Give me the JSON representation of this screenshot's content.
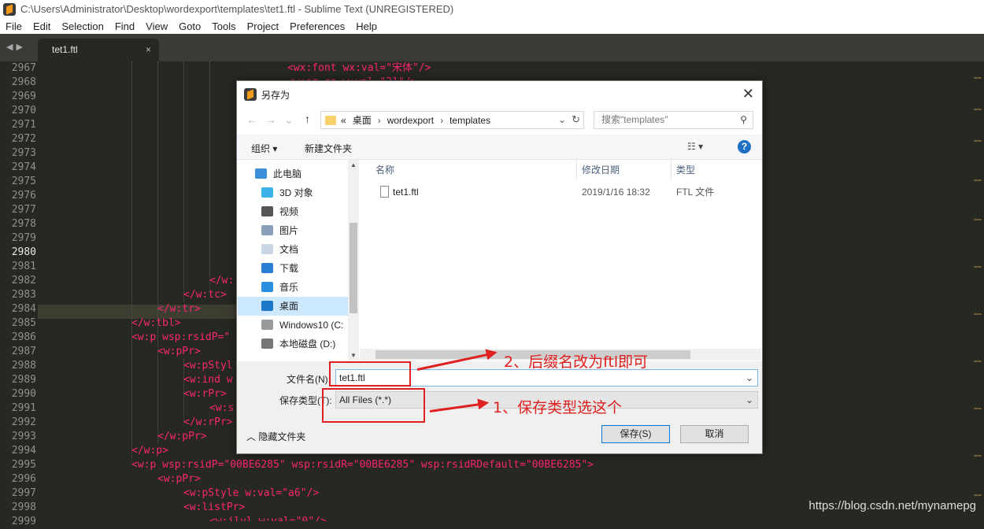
{
  "window": {
    "title": "C:\\Users\\Administrator\\Desktop\\wordexport\\templates\\tet1.ftl - Sublime Text (UNREGISTERED)"
  },
  "menu": [
    "File",
    "Edit",
    "Selection",
    "Find",
    "View",
    "Goto",
    "Tools",
    "Project",
    "Preferences",
    "Help"
  ],
  "tab": {
    "label": "tet1.ftl",
    "close": "×"
  },
  "editor": {
    "line_numbers": [
      "2967",
      "2968",
      "2969",
      "2970",
      "2971",
      "2972",
      "2973",
      "2974",
      "2975",
      "2976",
      "2977",
      "2978",
      "2979",
      "2980",
      "2981",
      "2982",
      "2983",
      "2984",
      "2985",
      "2986",
      "2987",
      "2988",
      "2989",
      "2990",
      "2991",
      "2992",
      "2993",
      "2994",
      "2995",
      "2996",
      "2997",
      "2998",
      "2999"
    ],
    "current_line": "2980",
    "lines": [
      {
        "text": "<wx:font wx:val=\"宋体\"/>"
      },
      {
        "text": "<w:sz-cs w:val=\"21\"/>"
      },
      {
        "text": "</w:"
      },
      {
        "text": "</w:tc>"
      },
      {
        "text": "</w:tr>"
      },
      {
        "text": "</w:tbl>"
      },
      {
        "text": "<w:p wsp:rsidP=\""
      },
      {
        "text": "<w:pPr>"
      },
      {
        "text": "<w:pStyl"
      },
      {
        "text": "<w:ind w"
      },
      {
        "text": "<w:rPr>"
      },
      {
        "text": "<w:s"
      },
      {
        "text": "</w:rPr>"
      },
      {
        "text": "</w:pPr>"
      },
      {
        "text": "</w:p>"
      },
      {
        "text": "<w:p wsp:rsidP=\"00BE6285\" wsp:rsidR=\"00BE6285\" wsp:rsidRDefault=\"00BE6285\">"
      },
      {
        "text": "<w:pPr>"
      },
      {
        "text": "<w:pStyle w:val=\"a6\"/>"
      },
      {
        "text": "<w:listPr>"
      },
      {
        "text": "<w:ilvl w:val=\"0\"/>"
      }
    ]
  },
  "dialog": {
    "title": "另存为",
    "close": "✕",
    "breadcrumbs": [
      "«",
      "桌面",
      "›",
      "wordexport",
      "›",
      "templates"
    ],
    "search_placeholder": "搜索\"templates\"",
    "organize": "组织 ▾",
    "new_folder": "新建文件夹",
    "nav_items": [
      "此电脑",
      "3D 对象",
      "视频",
      "图片",
      "文档",
      "下载",
      "音乐",
      "桌面",
      "Windows10 (C:",
      "本地磁盘 (D:)"
    ],
    "selected_nav": "桌面",
    "columns": {
      "name": "名称",
      "date": "修改日期",
      "type": "类型"
    },
    "files": [
      {
        "name": "tet1.ftl",
        "date": "2019/1/16 18:32",
        "type": "FTL 文件"
      }
    ],
    "filename_label": "文件名(N):",
    "filename_value": "tet1.ftl",
    "filetype_label": "保存类型(T):",
    "filetype_value": "All Files (*.*)",
    "hide_folders": "隐藏文件夹",
    "save_button": "保存(S)",
    "cancel_button": "取消"
  },
  "annotations": {
    "step1": "1、保存类型选这个",
    "step2": "2、后缀名改为ftl即可",
    "color": "#e02020"
  },
  "watermark": "https://blog.csdn.net/mynamepg"
}
